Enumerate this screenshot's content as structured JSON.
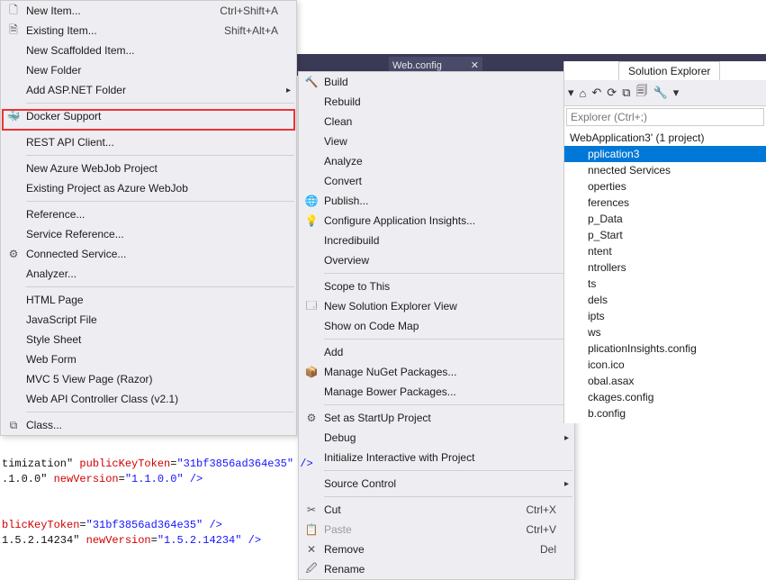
{
  "addMenu": {
    "items": [
      {
        "label": "New Item...",
        "shortcut": "Ctrl+Shift+A",
        "icon": "🗋"
      },
      {
        "label": "Existing Item...",
        "shortcut": "Shift+Alt+A",
        "icon": "🗎"
      },
      {
        "label": "New Scaffolded Item...",
        "shortcut": "",
        "icon": ""
      },
      {
        "label": "New Folder",
        "shortcut": "",
        "icon": ""
      },
      {
        "label": "Add ASP.NET Folder",
        "shortcut": "",
        "icon": "",
        "arrow": true
      }
    ],
    "docker": {
      "label": "Docker Support",
      "icon": "🐳"
    },
    "rest": {
      "label": "REST API Client...",
      "icon": ""
    },
    "azure": [
      {
        "label": "New Azure WebJob Project",
        "icon": ""
      },
      {
        "label": "Existing Project as Azure WebJob",
        "icon": ""
      }
    ],
    "refs": [
      {
        "label": "Reference...",
        "icon": ""
      },
      {
        "label": "Service Reference...",
        "icon": ""
      },
      {
        "label": "Connected Service...",
        "icon": "⚙"
      },
      {
        "label": "Analyzer...",
        "icon": ""
      }
    ],
    "files": [
      {
        "label": "HTML Page"
      },
      {
        "label": "JavaScript File"
      },
      {
        "label": "Style Sheet"
      },
      {
        "label": "Web Form"
      },
      {
        "label": "MVC 5 View Page (Razor)"
      },
      {
        "label": "Web API Controller Class (v2.1)"
      }
    ],
    "class": {
      "label": "Class...",
      "icon": "⧉"
    }
  },
  "ctxMenu": {
    "top": [
      {
        "label": "Build",
        "icon": "🔨"
      },
      {
        "label": "Rebuild"
      },
      {
        "label": "Clean"
      },
      {
        "label": "View",
        "arrow": true
      },
      {
        "label": "Analyze",
        "arrow": true
      },
      {
        "label": "Convert",
        "arrow": true
      },
      {
        "label": "Publish...",
        "icon": "🌐"
      },
      {
        "label": "Configure Application Insights...",
        "icon": "💡"
      },
      {
        "label": "Incredibuild",
        "arrow": true
      },
      {
        "label": "Overview"
      }
    ],
    "scope": [
      {
        "label": "Scope to This"
      },
      {
        "label": "New Solution Explorer View",
        "icon": "🗔"
      },
      {
        "label": "Show on Code Map",
        "icon": ""
      }
    ],
    "add": [
      {
        "label": "Add",
        "arrow": true
      },
      {
        "label": "Manage NuGet Packages...",
        "icon": "📦"
      },
      {
        "label": "Manage Bower Packages..."
      }
    ],
    "startup": {
      "label": "Set as StartUp Project",
      "icon": "⚙"
    },
    "debug": {
      "label": "Debug",
      "arrow": true
    },
    "init": {
      "label": "Initialize Interactive with Project"
    },
    "source": {
      "label": "Source Control",
      "arrow": true
    },
    "edit": [
      {
        "label": "Cut",
        "shortcut": "Ctrl+X",
        "icon": "✂"
      },
      {
        "label": "Paste",
        "shortcut": "Ctrl+V",
        "icon": "📋",
        "disabled": true
      },
      {
        "label": "Remove",
        "shortcut": "Del",
        "icon": "✕"
      },
      {
        "label": "Rename",
        "icon": "🖉"
      }
    ]
  },
  "solExp": {
    "tabTitle": "Solution Explorer",
    "searchPlaceholder": "Explorer (Ctrl+;)",
    "root": "WebApplication3' (1 project)",
    "project": "pplication3",
    "children": [
      "nnected Services",
      "operties",
      "ferences",
      "p_Data",
      "p_Start",
      "ntent",
      "ntrollers",
      "ts",
      "dels",
      "ipts",
      "ws",
      "plicationInsights.config",
      "icon.ico",
      "obal.asax",
      "ckages.config",
      "b.config"
    ]
  },
  "backTab": {
    "label": "Web.config",
    "close": "✕"
  },
  "code": {
    "l1a": "timization\" ",
    "l1b": "publicKeyToken",
    "l1c": "=",
    "l1d": "\"31bf3856ad364e35\"",
    "l1e": " />",
    "l2a": ".1.0.0\" ",
    "l2b": "newVersion",
    "l2c": "=",
    "l2d": "\"1.1.0.0\"",
    "l2e": " />",
    "l3a": "blicKeyToken",
    "l3b": "=",
    "l3c": "\"31bf3856ad364e35\"",
    "l3d": " />",
    "l4a": "1.5.2.14234\" ",
    "l4b": "newVersion",
    "l4c": "=",
    "l4d": "\"1.5.2.14234\"",
    "l4e": " />"
  }
}
